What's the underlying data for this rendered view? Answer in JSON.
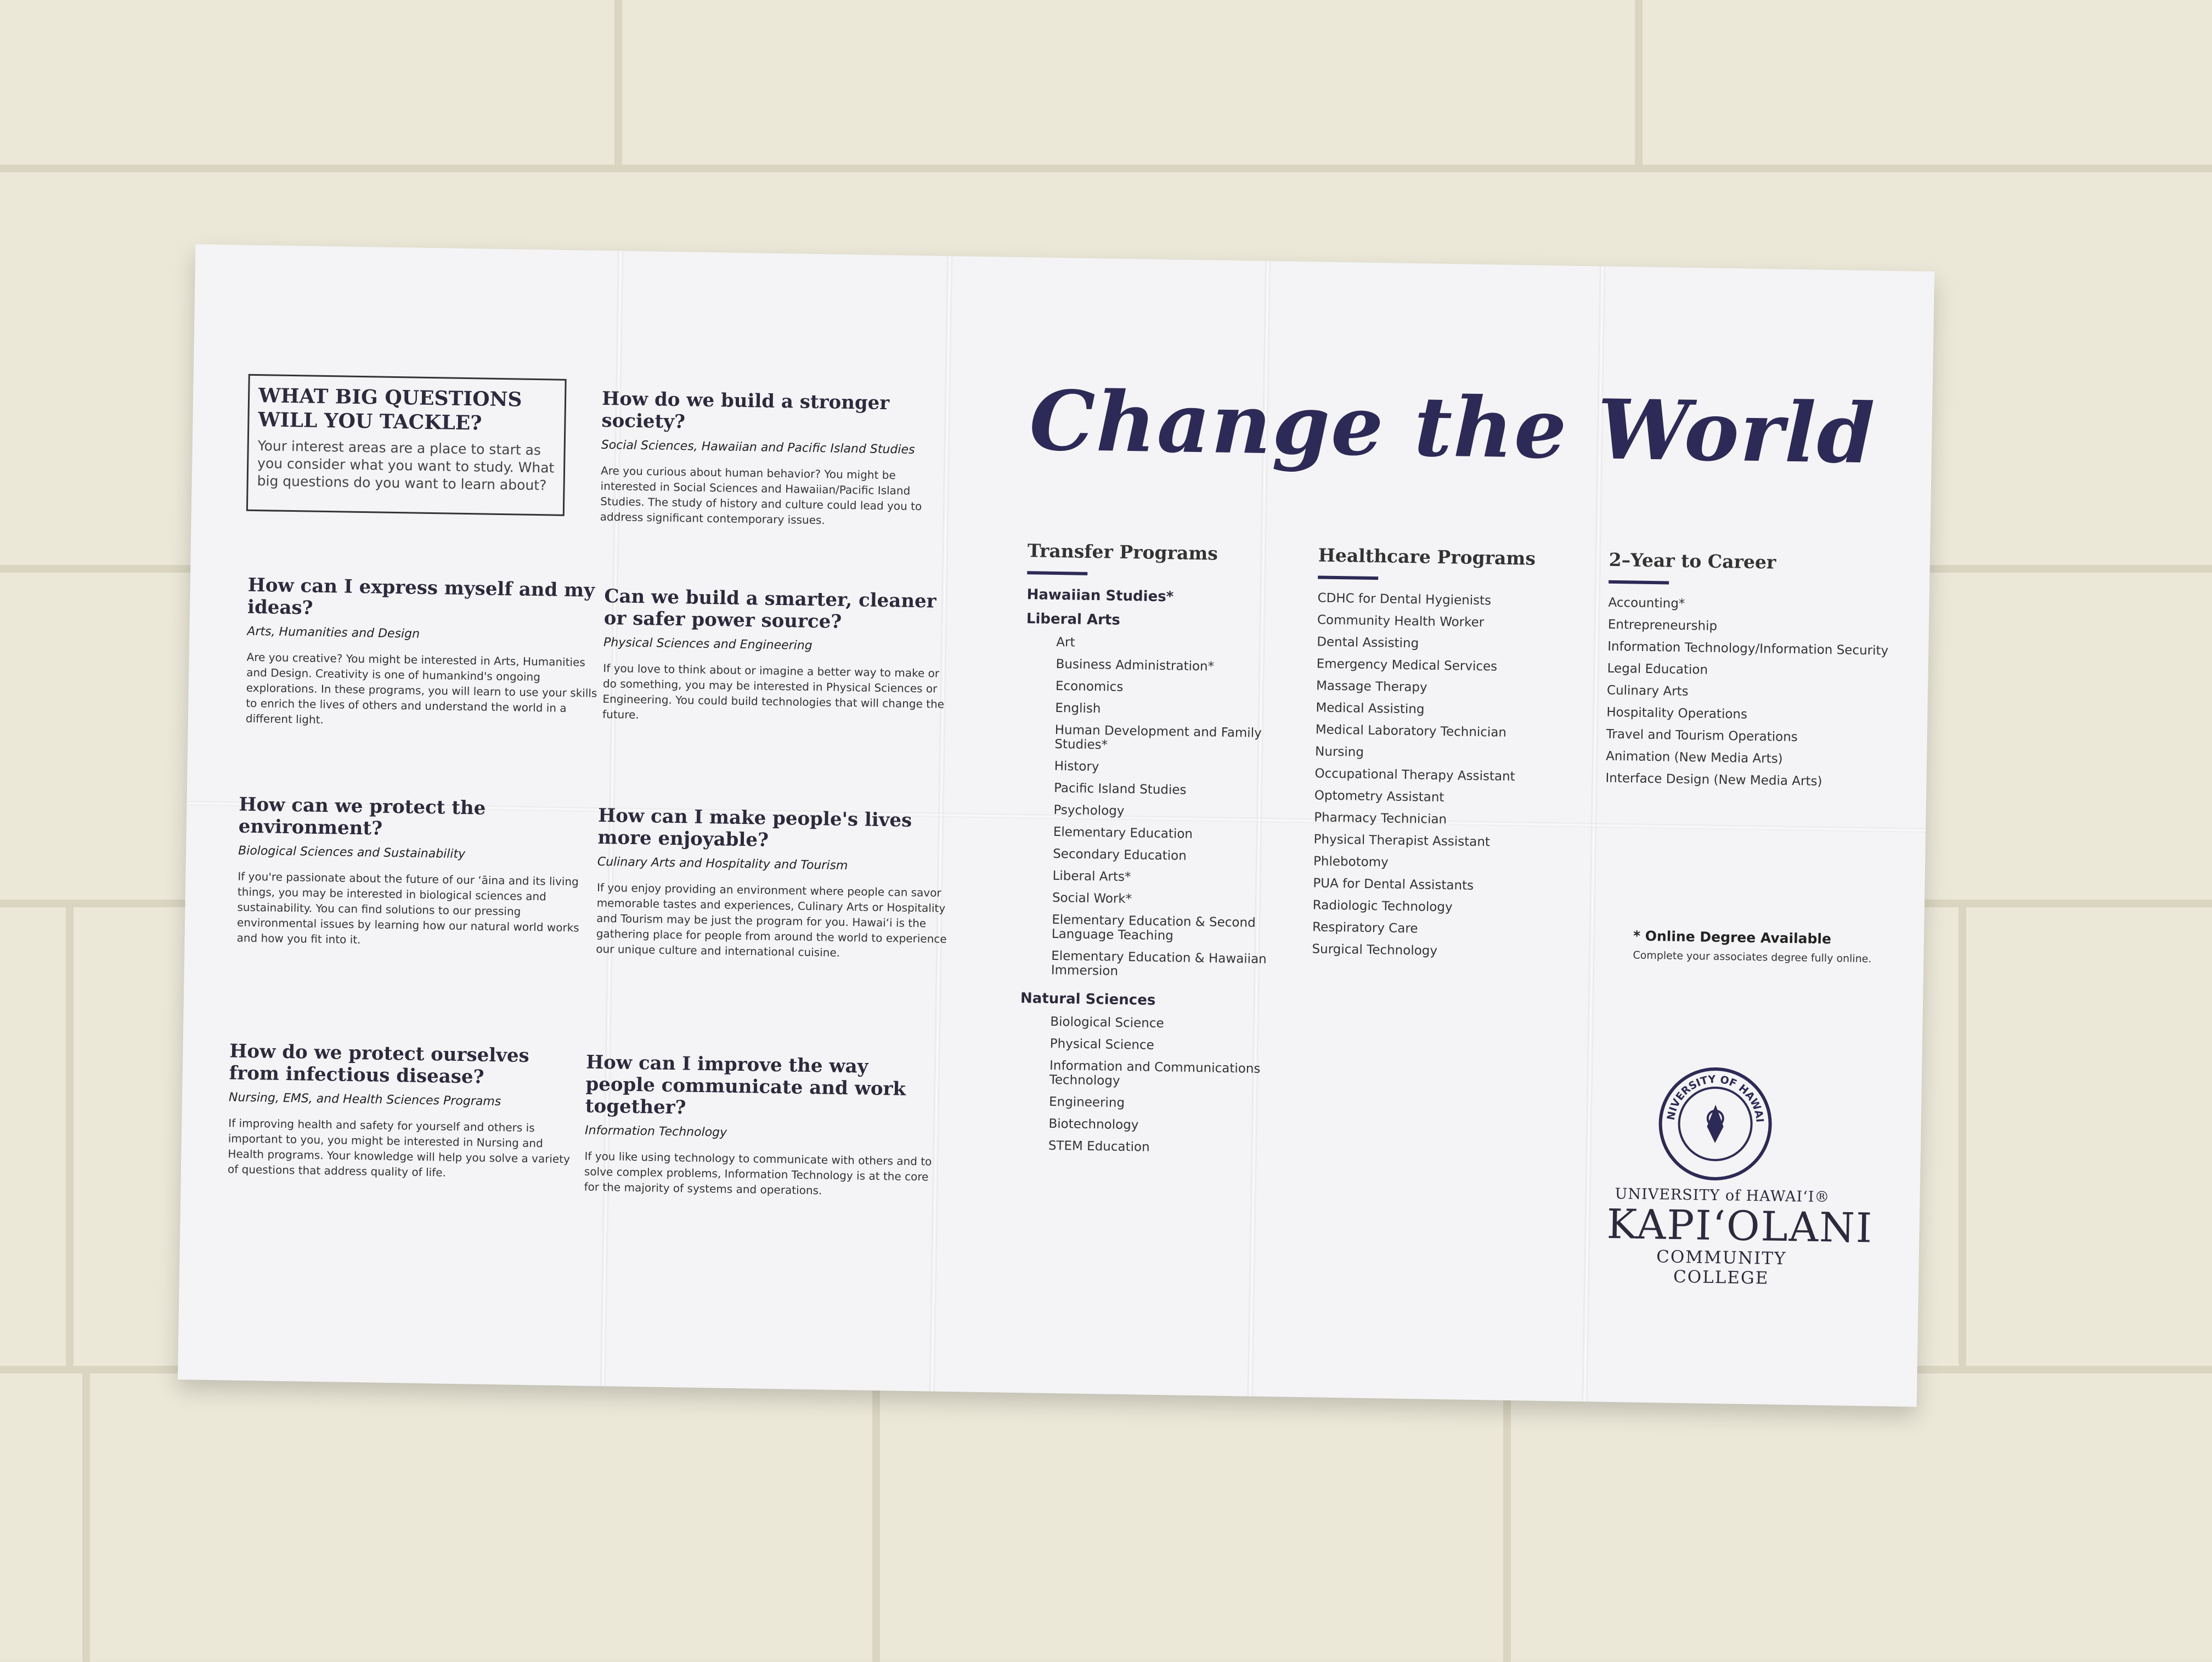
{
  "intro": {
    "heading": "WHAT BIG QUESTIONS WILL YOU TACKLE?",
    "text": "Your interest areas are a place to start as you consider what you want to study. What big questions do you want to learn about?"
  },
  "questions": [
    {
      "title": "How do we build a stronger society?",
      "area": "Social Sciences, Hawaiian and Pacific Island Studies",
      "text": "Are you curious about human behavior? You might be interested in Social Sciences and Hawaiian/Pacific Island Studies. The study of history and culture could lead you to address significant contemporary issues."
    },
    {
      "title": "How can I express myself and my ideas?",
      "area": "Arts, Humanities and Design",
      "text": "Are you creative? You might be interested in Arts, Humanities and Design. Creativity is one of humankind's ongoing explorations. In these programs, you will learn to use your skills to enrich the lives of others and understand the world in a different light."
    },
    {
      "title": "Can we build a smarter, cleaner or safer power source?",
      "area": "Physical Sciences and Engineering",
      "text": "If you love to think about or imagine a better way to make or do something, you may be interested in Physical Sciences or Engineering. You could build technologies that will change the future."
    },
    {
      "title": "How can we protect the environment?",
      "area": "Biological Sciences and Sustainability",
      "text": "If you're passionate about the future of our ʻāina and its living things, you may be interested in biological sciences and sustainability. You can find solutions to our pressing environmental issues by learning how our natural world works and how you fit into it."
    },
    {
      "title": "How can I make people's lives more enjoyable?",
      "area": "Culinary Arts and Hospitality and Tourism",
      "text": "If you enjoy providing an environment where people can savor memorable tastes and experiences, Culinary Arts or Hospitality and Tourism may be just the program for you. Hawaiʻi is the gathering place for people from around the world to experience our unique culture and international cuisine."
    },
    {
      "title": "How do we protect ourselves from infectious disease?",
      "area": "Nursing, EMS, and Health Sciences Programs",
      "text": "If improving health and safety for yourself and others is important to you, you might be interested in Nursing and Health programs. Your knowledge will help you solve a variety of questions that address quality of life."
    },
    {
      "title": "How can I improve the way people communicate and work together?",
      "area": "Information Technology",
      "text": "If you like using technology to communicate with others and to solve complex problems, Information Technology is at the core for the majority of systems and operations."
    }
  ],
  "headline": "Change the World",
  "transfer": {
    "heading": "Transfer Programs",
    "hawaiian": "Hawaiian Studies*",
    "liberal_heading": "Liberal Arts",
    "liberal": [
      "Art",
      "Business Administration*",
      "Economics",
      "English",
      "Human Development and Family Studies*",
      "History",
      "Pacific Island Studies",
      "Psychology",
      "Elementary Education",
      "Secondary Education",
      "Liberal Arts*",
      "Social Work*",
      "Elementary Education & Second Language Teaching",
      "Elementary Education & Hawaiian Immersion"
    ],
    "natural_heading": "Natural Sciences",
    "natural": [
      "Biological Science",
      "Physical Science",
      "Information and Communications Technology",
      "Engineering",
      "Biotechnology",
      "STEM Education"
    ]
  },
  "healthcare": {
    "heading": "Healthcare Programs",
    "items": [
      "CDHC for Dental Hygienists",
      "Community Health Worker",
      "Dental Assisting",
      "Emergency Medical Services",
      "Massage Therapy",
      "Medical Assisting",
      "Medical Laboratory Technician",
      "Nursing",
      "Occupational Therapy Assistant",
      "Optometry Assistant",
      "Pharmacy Technician",
      "Physical Therapist Assistant",
      "Phlebotomy",
      "PUA for Dental Assistants",
      "Radiologic Technology",
      "Respiratory Care",
      "Surgical Technology"
    ]
  },
  "career": {
    "heading": "2–Year to Career",
    "items": [
      "Accounting*",
      "Entrepreneurship",
      "Information Technology/Information Security",
      "Legal Education",
      "Culinary Arts",
      "Hospitality Operations",
      "Travel and Tourism Operations",
      "Animation (New Media Arts)",
      "Interface Design (New Media Arts)"
    ]
  },
  "online": {
    "title": "* Online Degree Available",
    "text": "Complete your associates degree fully online."
  },
  "logo": {
    "university": "UNIVERSITY of HAWAIʻI®",
    "name": "KAPIʻOLANI",
    "college": "COMMUNITY COLLEGE",
    "seal_text": "UNIVERSITY OF HAWAIʻI"
  },
  "colors": {
    "ink": "#2e2a57",
    "paper": "#f4f4f6",
    "wall": "#ebe8d8"
  }
}
